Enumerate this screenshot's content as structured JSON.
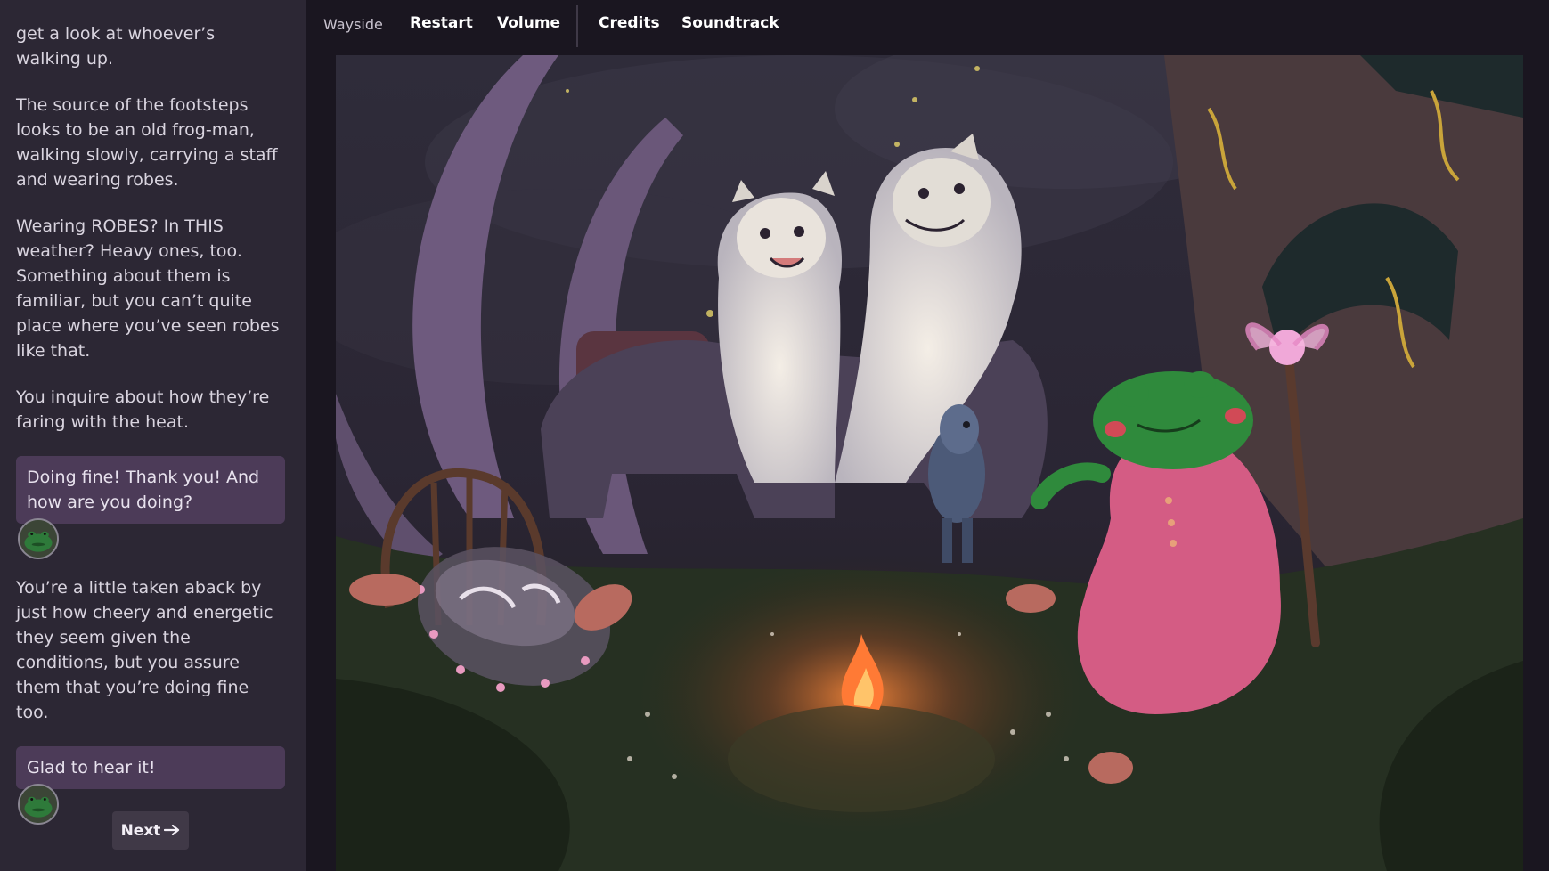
{
  "nav": {
    "title": "Wayside",
    "items": [
      "Restart",
      "Volume",
      "Credits",
      "Soundtrack"
    ]
  },
  "story": {
    "paragraph_1": "get a look at whoever’s walking up.",
    "paragraph_2": "The source of the footsteps looks to be an old frog-man, walking slowly, carrying a staff and wearing robes.",
    "paragraph_3": "Wearing ROBES? In THIS weather? Heavy ones, too. Something about them is familiar, but you can’t quite place where you’ve seen robes like that.",
    "paragraph_4": "You inquire about how they’re faring with the heat.",
    "speech_1": "Doing fine! Thank you! And how are you doing?",
    "paragraph_5": "You’re a little taken aback by just how cheery and energetic they seem given the conditions, but you assure them that you’re doing fine too.",
    "speech_2": "Glad to hear it!"
  },
  "next_button": {
    "label": "Next",
    "icon": "arrow-right-icon"
  },
  "colors": {
    "sidebar_bg": "#2c2734",
    "page_bg": "#1a1620",
    "bubble_bg": "#4c3b58",
    "button_bg": "#403947"
  }
}
